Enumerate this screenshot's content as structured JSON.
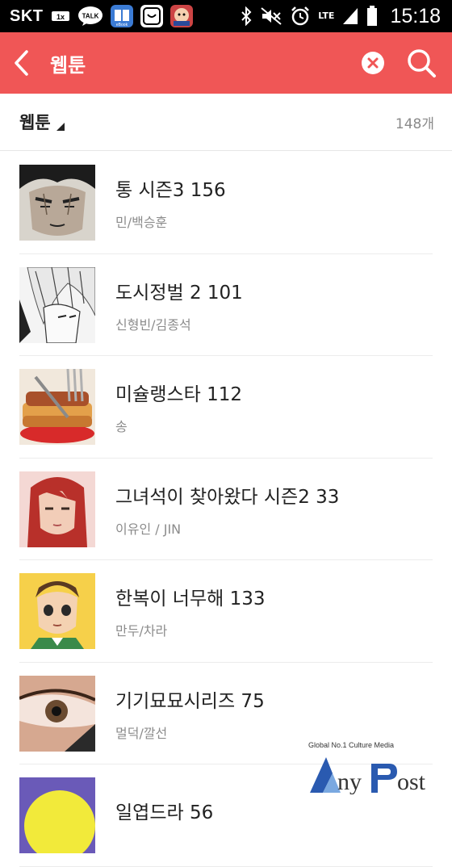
{
  "status_bar": {
    "carrier": "SKT",
    "time": "15:18",
    "network": "LTE",
    "icons": [
      "1x-icon",
      "kakaotalk-icon",
      "ebook-icon",
      "app-icon",
      "game-icon",
      "bluetooth-icon",
      "mute-icon",
      "alarm-icon",
      "signal-icon",
      "battery-icon"
    ],
    "kakao_label": "TALK"
  },
  "header": {
    "title": "웹툰",
    "back_icon": "back-arrow-icon",
    "clear_icon": "clear-icon",
    "search_icon": "search-icon",
    "background": "#f05656"
  },
  "filter": {
    "label": "웹툰",
    "count": "148개"
  },
  "items": [
    {
      "title": "통 시즌3 156",
      "author": "민/백승훈"
    },
    {
      "title": "도시정벌 2 101",
      "author": "신형빈/김종석"
    },
    {
      "title": "미슐랭스타 112",
      "author": "송"
    },
    {
      "title": "그녀석이 찾아왔다 시즌2 33",
      "author": "이유인 / JIN"
    },
    {
      "title": "한복이 너무해 133",
      "author": "만두/차라"
    },
    {
      "title": "기기묘묘시리즈 75",
      "author": "멀덕/깔선"
    },
    {
      "title": "일엽드라 56",
      "author": ""
    }
  ],
  "watermark": {
    "tagline": "Global No.1 Culture Media",
    "brand": "AnyPost"
  }
}
